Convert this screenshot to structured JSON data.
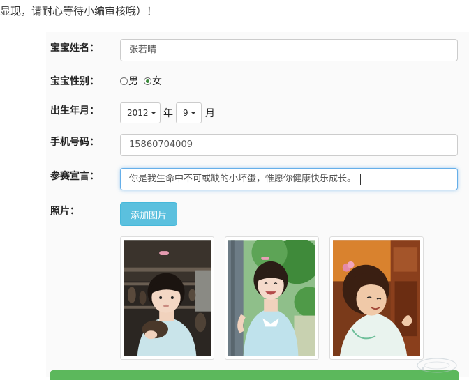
{
  "notice": {
    "text": "显现，请耐心等待小编审核哦）！"
  },
  "form": {
    "name": {
      "label": "宝宝姓名：",
      "value": "张若晴"
    },
    "gender": {
      "label": "宝宝性别：",
      "options": [
        {
          "label": "男",
          "checked": false
        },
        {
          "label": "女",
          "checked": true
        }
      ]
    },
    "birth": {
      "label": "出生年月：",
      "year": "2012",
      "year_unit": "年",
      "month": "9",
      "month_unit": "月"
    },
    "phone": {
      "label": "手机号码：",
      "value": "15860704009"
    },
    "declaration": {
      "label": "参赛宣言：",
      "value": "你是我生命中不可或缺的小坏蛋，惟愿你健康快乐成长。"
    },
    "photos": {
      "label": "照片：",
      "add_button": "添加图片",
      "items": [
        "photo-1",
        "photo-2",
        "photo-3"
      ]
    }
  },
  "colors": {
    "info_button": "#5bc0de",
    "submit_button": "#5cb85c",
    "focus_border": "#66afe9"
  },
  "icons": [
    "radio-icon",
    "dropdown-caret-icon",
    "watermark-logo-icon"
  ]
}
